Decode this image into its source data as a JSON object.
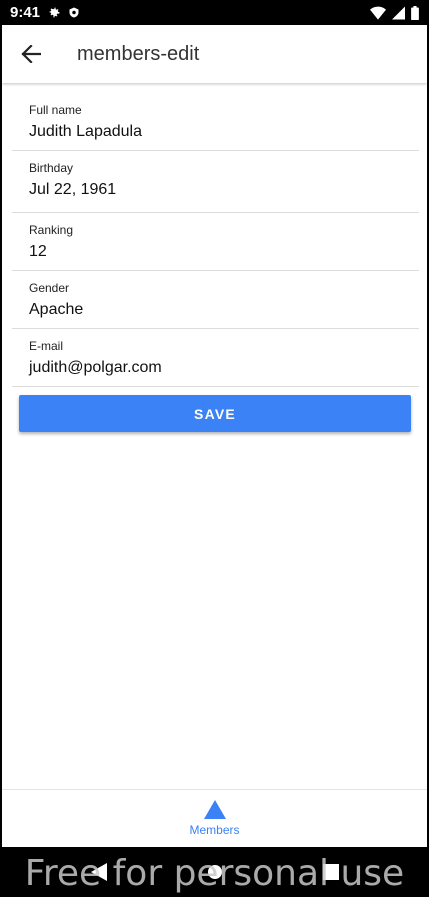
{
  "status_bar": {
    "time": "9:41"
  },
  "app_bar": {
    "title": "members-edit"
  },
  "form": {
    "fields": [
      {
        "label": "Full name",
        "value": "Judith Lapadula"
      },
      {
        "label": "Birthday",
        "value": "Jul 22, 1961"
      },
      {
        "label": "Ranking",
        "value": "12"
      },
      {
        "label": "Gender",
        "value": "Apache"
      },
      {
        "label": "E-mail",
        "value": "judith@polgar.com"
      }
    ],
    "save_label": "SAVE"
  },
  "bottom_nav": {
    "members_label": "Members"
  },
  "watermark": "Free for personal use",
  "colors": {
    "accent": "#3b82f6",
    "app_bar_bg": "#ffffff",
    "status_bar_bg": "#000000"
  }
}
